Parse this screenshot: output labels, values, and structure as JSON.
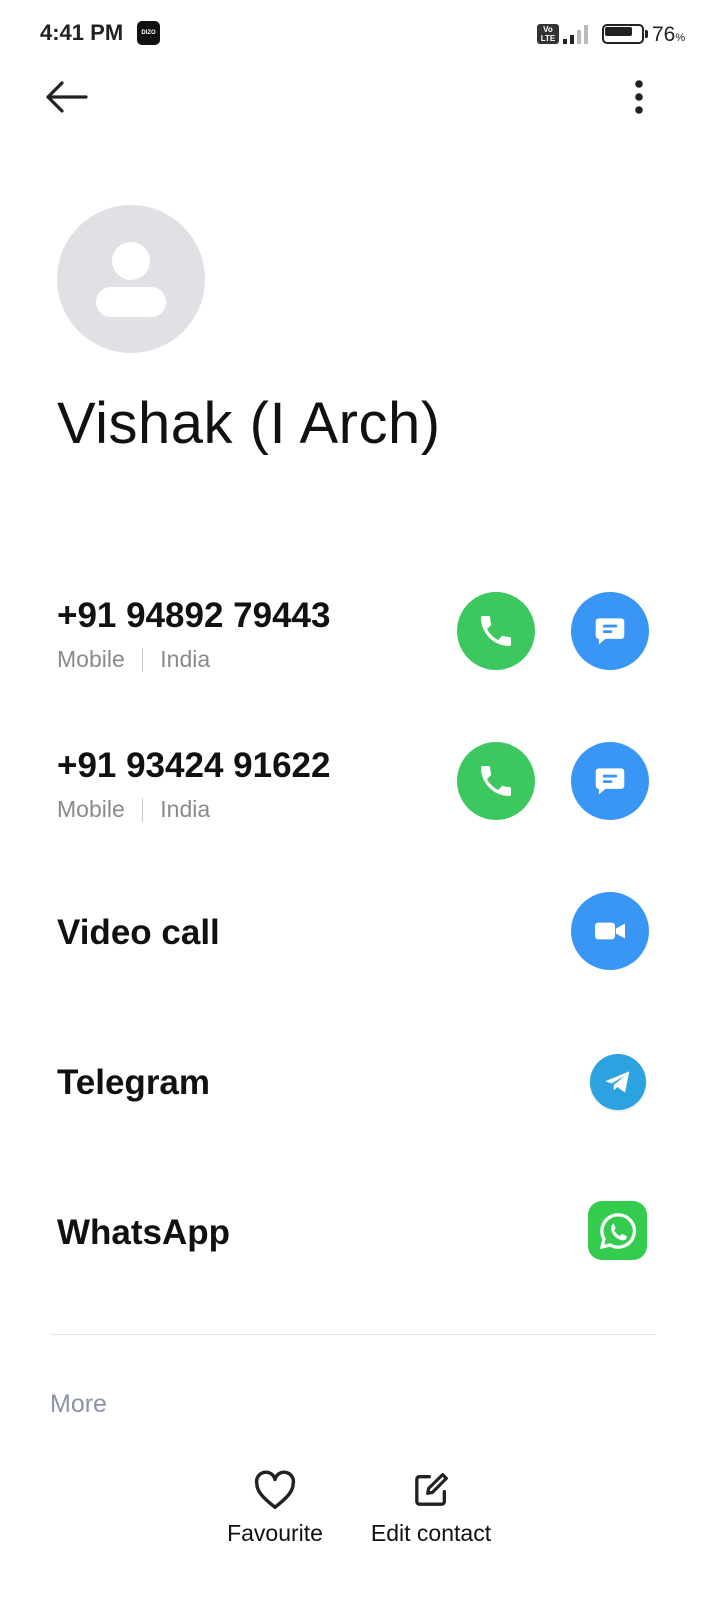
{
  "status_bar": {
    "time": "4:41 PM",
    "app_badge": "DIZO",
    "network_badge_top": "Vo",
    "network_badge_bottom": "LTE",
    "battery_percent": "76",
    "battery_unit": "%",
    "battery_level": 0.76
  },
  "header": {
    "back_icon": "arrow-left-icon",
    "menu_icon": "more-vertical-icon"
  },
  "contact": {
    "name": "Vishak (I Arch)",
    "avatar_icon": "person-icon"
  },
  "phones": [
    {
      "number": "+91 94892 79443",
      "type": "Mobile",
      "region": "India"
    },
    {
      "number": "+91 93424 91622",
      "type": "Mobile",
      "region": "India"
    }
  ],
  "actions": {
    "video_call": "Video call",
    "telegram": "Telegram",
    "whatsapp": "WhatsApp"
  },
  "more_label": "More",
  "bottom_bar": {
    "favourite": "Favourite",
    "edit_contact": "Edit contact"
  },
  "colors": {
    "call_green": "#3cc85f",
    "message_blue": "#3a96f5",
    "telegram_blue": "#2aa3e0",
    "whatsapp_green": "#33cc4f"
  }
}
